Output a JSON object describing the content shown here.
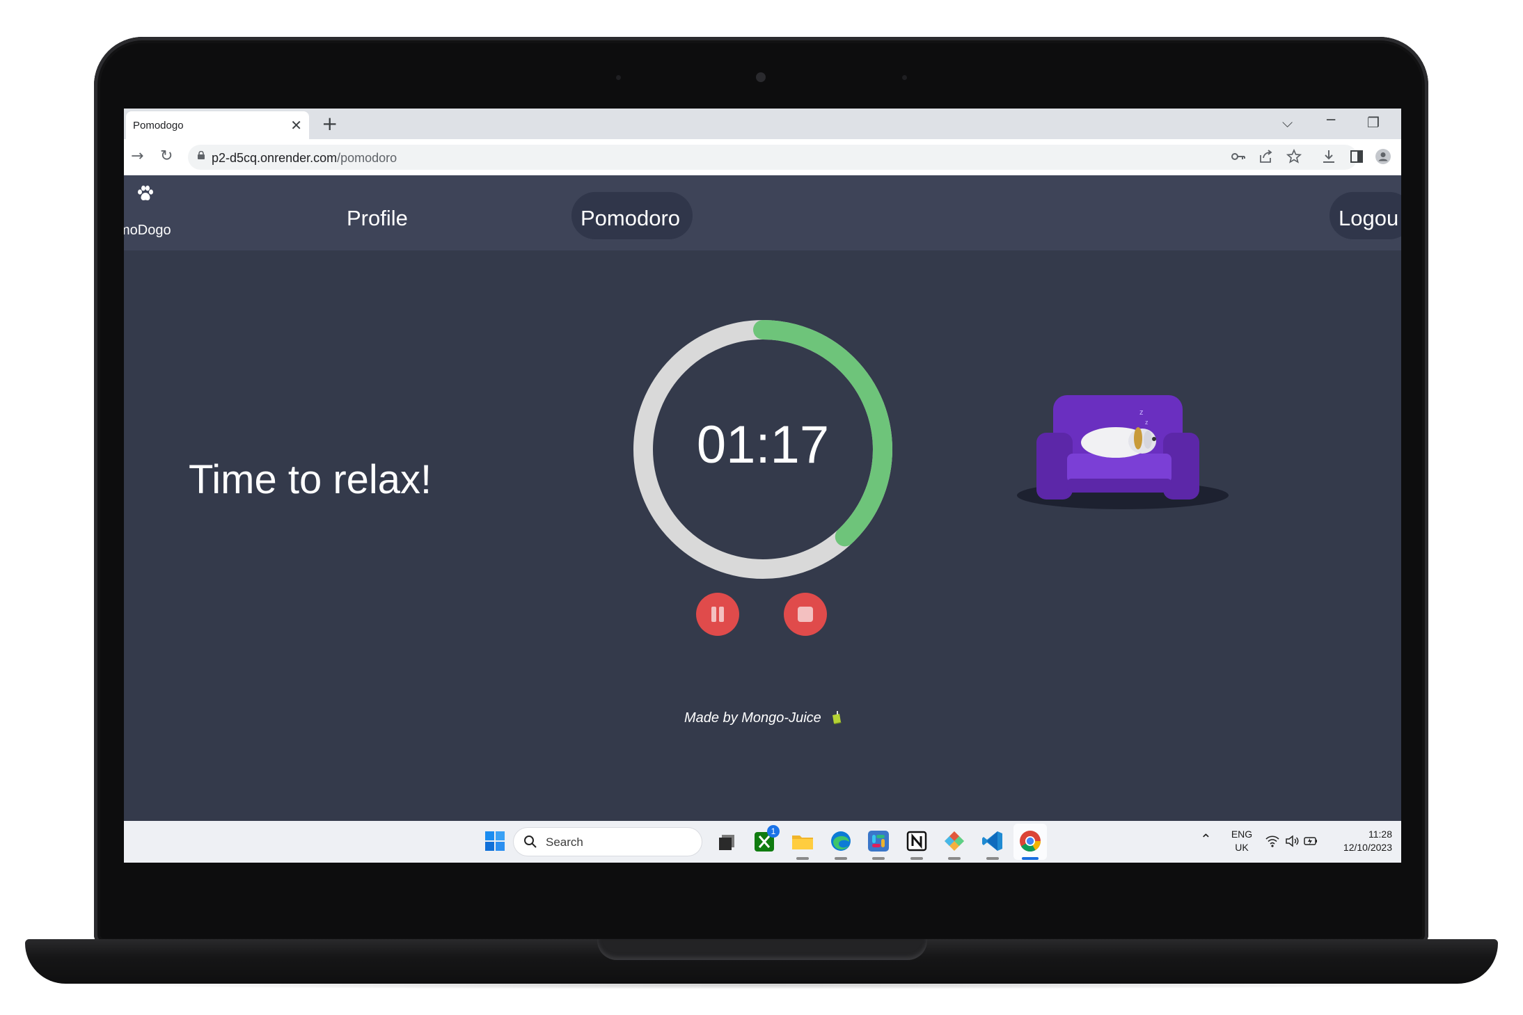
{
  "browser": {
    "tab_title": "Pomodogo",
    "url_host": "p2-d5cq.onrender.com",
    "url_path": "/pomodoro"
  },
  "app": {
    "brand": "moDogo",
    "nav": {
      "profile": "Profile",
      "pomodoro": "Pomodoro",
      "logout": "Logou"
    },
    "message": "Time to relax!",
    "timer": {
      "display": "01:17",
      "remaining_fraction": 0.38
    },
    "footer": "Made by Mongo-Juice",
    "colors": {
      "background": "#343a4b",
      "navbar": "#3e4458",
      "timer_progress": "#6ec47a",
      "timer_track": "#d9d9d9",
      "control_buttons": "#e04b4b",
      "sofa": "#6a2fc0"
    }
  },
  "taskbar": {
    "search_label": "Search",
    "language": "ENG",
    "region": "UK",
    "time": "11:28",
    "date": "12/10/2023",
    "badge_count": "1",
    "apps": [
      "start-icon",
      "task-view-icon",
      "xbox-icon",
      "file-explorer-icon",
      "edge-icon",
      "slack-icon",
      "notion-icon",
      "git-icon",
      "vscode-icon",
      "chrome-icon"
    ]
  }
}
